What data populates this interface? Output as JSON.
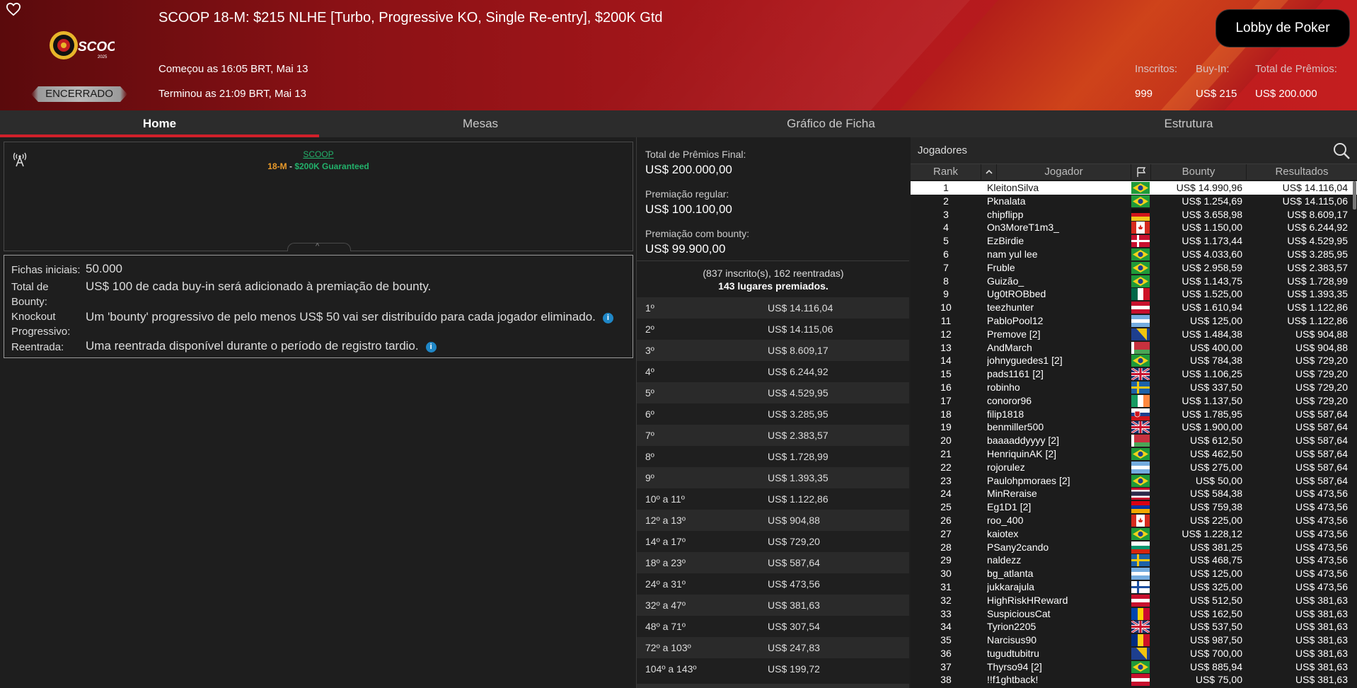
{
  "header": {
    "title": "SCOOP 18-M: $215 NLHE [Turbo, Progressive KO, Single Re-entry], $200K Gtd",
    "started": "Começou as 16:05 BRT, Mai 13",
    "ended": "Terminou as 21:09 BRT, Mai 13",
    "status": "ENCERRADO",
    "logo_text": "SCOOP",
    "logo_year": "2025",
    "lobby_button": "Lobby de Poker",
    "stats": {
      "entrants_label": "Inscritos:",
      "entrants_value": "999",
      "buyin_label": "Buy-In:",
      "buyin_value": "US$ 215",
      "total_label": "Total de Prêmios:",
      "total_value": "US$ 200.000"
    },
    "colors": {
      "brand_red": "#b3191d",
      "accent_green": "#22b26b",
      "accent_orange": "#e99a2a"
    }
  },
  "tabs": [
    {
      "label": "Home",
      "active": true
    },
    {
      "label": "Mesas",
      "active": false
    },
    {
      "label": "Gráfico de Ficha",
      "active": false
    },
    {
      "label": "Estrutura",
      "active": false
    }
  ],
  "broadcast": {
    "link": "SCOOP",
    "sub_prefix": "18-M",
    "sub_sep": " - ",
    "sub_suffix": "$200K Guaranteed"
  },
  "info": {
    "starting_chips_label": "Fichas iniciais:",
    "starting_chips_value": "50.000",
    "bounty_total_label_1": "Total de",
    "bounty_total_label_2": "Bounty:",
    "bounty_total_text": "US$ 100 de cada buy-in será adicionado à premiação de bounty.",
    "pko_label_1": "Knockout",
    "pko_label_2": "Progressivo:",
    "pko_text": "Um 'bounty' progressivo de pelo menos US$ 50 vai ser distribuído para cada jogador eliminado.",
    "reentry_label": "Reentrada:",
    "reentry_text": "Uma reentrada disponível durante o período de registro tardio."
  },
  "prizes": {
    "final_label": "Total de Prêmios Final:",
    "final_value": "US$ 200.000,00",
    "regular_label": "Premiação regular:",
    "regular_value": "US$ 100.100,00",
    "bounty_label": "Premiação com bounty:",
    "bounty_value": "US$ 99.900,00",
    "registrations": "(837 inscrito(s), 162 reentradas)",
    "places_paid": "143 lugares premiados."
  },
  "payouts": [
    [
      "1º",
      "US$ 14.116,04"
    ],
    [
      "2º",
      "US$ 14.115,06"
    ],
    [
      "3º",
      "US$ 8.609,17"
    ],
    [
      "4º",
      "US$ 6.244,92"
    ],
    [
      "5º",
      "US$ 4.529,95"
    ],
    [
      "6º",
      "US$ 3.285,95"
    ],
    [
      "7º",
      "US$ 2.383,57"
    ],
    [
      "8º",
      "US$ 1.728,99"
    ],
    [
      "9º",
      "US$ 1.393,35"
    ],
    [
      "10º a 11º",
      "US$ 1.122,86"
    ],
    [
      "12º a 13º",
      "US$ 904,88"
    ],
    [
      "14º a 17º",
      "US$ 729,20"
    ],
    [
      "18º a 23º",
      "US$ 587,64"
    ],
    [
      "24º a 31º",
      "US$ 473,56"
    ],
    [
      "32º a 47º",
      "US$ 381,63"
    ],
    [
      "48º a 71º",
      "US$ 307,54"
    ],
    [
      "72º a 103º",
      "US$ 247,83"
    ],
    [
      "104º a 143º",
      "US$ 199,72"
    ]
  ],
  "players": {
    "title": "Jogadores",
    "columns": {
      "rank": "Rank",
      "player": "Jogador",
      "bounty": "Bounty",
      "results": "Resultados"
    },
    "rows": [
      [
        "1",
        "KleitonSilva",
        "br",
        "US$ 14.990,96",
        "US$ 14.116,04"
      ],
      [
        "2",
        "Pknalata",
        "br",
        "US$ 1.254,69",
        "US$ 14.115,06"
      ],
      [
        "3",
        "chipflipp",
        "de",
        "US$ 3.658,98",
        "US$ 8.609,17"
      ],
      [
        "4",
        "On3MoreT1m3_",
        "ca",
        "US$ 1.150,00",
        "US$ 6.244,92"
      ],
      [
        "5",
        "EzBirdie",
        "dk",
        "US$ 1.173,44",
        "US$ 4.529,95"
      ],
      [
        "6",
        "nam yul lee",
        "br",
        "US$ 4.033,60",
        "US$ 3.285,95"
      ],
      [
        "7",
        "Fruble",
        "br",
        "US$ 2.958,59",
        "US$ 2.383,57"
      ],
      [
        "8",
        "Guizão_",
        "br",
        "US$ 1.143,75",
        "US$ 1.728,99"
      ],
      [
        "9",
        "Ug0tROBbed",
        "mx",
        "US$ 1.525,00",
        "US$ 1.393,35"
      ],
      [
        "10",
        "teezhunter",
        "at",
        "US$ 1.610,94",
        "US$ 1.122,86"
      ],
      [
        "11",
        "PabloPool12",
        "ar",
        "US$ 125,00",
        "US$ 1.122,86"
      ],
      [
        "12",
        "Premove [2]",
        "ba",
        "US$ 1.484,38",
        "US$ 904,88"
      ],
      [
        "13",
        "AndMarch",
        "by",
        "US$ 400,00",
        "US$ 904,88"
      ],
      [
        "14",
        "johnyguedes1 [2]",
        "br",
        "US$ 784,38",
        "US$ 729,20"
      ],
      [
        "15",
        "pads1161 [2]",
        "gb",
        "US$ 1.106,25",
        "US$ 729,20"
      ],
      [
        "16",
        "robinho",
        "se",
        "US$ 337,50",
        "US$ 729,20"
      ],
      [
        "17",
        "conoror96",
        "ie",
        "US$ 1.137,50",
        "US$ 729,20"
      ],
      [
        "18",
        "filip1818",
        "sk",
        "US$ 1.785,95",
        "US$ 587,64"
      ],
      [
        "19",
        "benmiller500",
        "gb",
        "US$ 1.900,00",
        "US$ 587,64"
      ],
      [
        "20",
        "baaaaddyyyy [2]",
        "by",
        "US$ 612,50",
        "US$ 587,64"
      ],
      [
        "21",
        "HenriquinAK [2]",
        "br",
        "US$ 462,50",
        "US$ 587,64"
      ],
      [
        "22",
        "rojorulez",
        "ar",
        "US$ 275,00",
        "US$ 587,64"
      ],
      [
        "23",
        "Paulohpmoraes [2]",
        "br",
        "US$ 50,00",
        "US$ 587,64"
      ],
      [
        "24",
        "MinReraise",
        "th",
        "US$ 584,38",
        "US$ 473,56"
      ],
      [
        "25",
        "Eg1D1 [2]",
        "am",
        "US$ 759,38",
        "US$ 473,56"
      ],
      [
        "26",
        "roo_400",
        "ca",
        "US$ 225,00",
        "US$ 473,56"
      ],
      [
        "27",
        "kaiotex",
        "br",
        "US$ 1.228,12",
        "US$ 473,56"
      ],
      [
        "28",
        "PSany2cando",
        "bg",
        "US$ 381,25",
        "US$ 473,56"
      ],
      [
        "29",
        "naldezz",
        "se",
        "US$ 468,75",
        "US$ 473,56"
      ],
      [
        "30",
        "bg_atlanta",
        "ar",
        "US$ 125,00",
        "US$ 473,56"
      ],
      [
        "31",
        "jukkarajula",
        "fi",
        "US$ 325,00",
        "US$ 473,56"
      ],
      [
        "32",
        "HighRiskHReward",
        "at",
        "US$ 512,50",
        "US$ 381,63"
      ],
      [
        "33",
        "SuspiciousCat",
        "md",
        "US$ 162,50",
        "US$ 381,63"
      ],
      [
        "34",
        "Tyrion2205",
        "gb",
        "US$ 537,50",
        "US$ 381,63"
      ],
      [
        "35",
        "Narcisus90",
        "ro",
        "US$ 987,50",
        "US$ 381,63"
      ],
      [
        "36",
        "tugudtubitru",
        "ba",
        "US$ 700,00",
        "US$ 381,63"
      ],
      [
        "37",
        "Thyrso94 [2]",
        "br",
        "US$ 885,94",
        "US$ 381,63"
      ],
      [
        "38",
        "!!f1ghtback!",
        "at",
        "US$ 75,00",
        "US$ 381,63"
      ]
    ]
  }
}
